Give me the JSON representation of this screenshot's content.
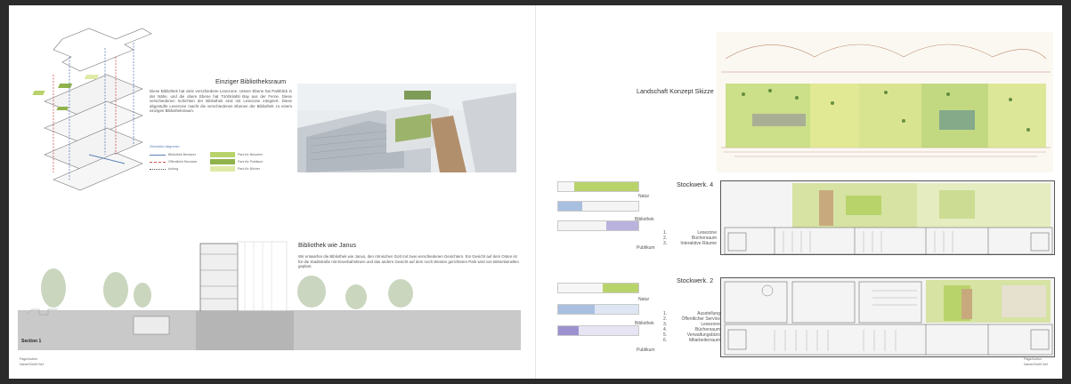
{
  "left_page": {
    "sec1_title": "Einziger Bibliotheksraum",
    "sec1_text": "Diese Bibliothek hat viele verschiedene Lesezone. Untere Ebene hat Parkblick in der Nähe, und die obere Ebene hat Töölönlahti Bay aus der Ferne. Diese verschiedenen Schichten der Bibliothek sind mit Lesezone integriert. Diese abgestufte Lesezone macht die verschiedenen Ebenen der Bibliothek zu einem einzigen Bibliotheksraum.",
    "legend_title": "Zirkulation diagramm",
    "legend_items": [
      {
        "line": "Bibliothek Benutzer",
        "box": "Park für Benutzer"
      },
      {
        "line": "Öffentliche Benutzer",
        "box": "Park für Publikum"
      },
      {
        "line": "Aufzug",
        "box": "Park für Bücher"
      }
    ],
    "sec2_title": "Bibliothek wie Janus",
    "sec2_text": "Wir entwarfen die Bibliothek wie Janus, den römischen Gott mit zwei verschiedenen Gesichtern. Ein Gesicht auf dem Osten ist für die Stadtstraße mit Eisenbahnlinien und das andere Gesicht auf dem noch Westen gerichteten Park wird von Birkenlamellen geplant.",
    "section_label": "Section 1",
    "footer_1": "Page/Author",
    "footer_2": "Name/Chef/Chef"
  },
  "right_page": {
    "sketch_title": "Landschaft Konzept Skizze",
    "floor4_title": "Stockwerk. 4",
    "floor2_title": "Stockwerk. 2",
    "bar_labels": [
      "Natur",
      "Bibliothek",
      "Publikum"
    ],
    "floor4_list": [
      {
        "n": "1.",
        "label": "Lesezone"
      },
      {
        "n": "2.",
        "label": "Büchersaum"
      },
      {
        "n": "3.",
        "label": "Interaktive Räume"
      }
    ],
    "floor2_list": [
      {
        "n": "1.",
        "label": "Ausstellung"
      },
      {
        "n": "2.",
        "label": "Öffentlicher Service"
      },
      {
        "n": "3.",
        "label": "Lesezone"
      },
      {
        "n": "4.",
        "label": "Büchersaum"
      },
      {
        "n": "5.",
        "label": "Verwaltungsbüro"
      },
      {
        "n": "6.",
        "label": "Mitarbeiterraum"
      }
    ],
    "footer_1": "Page/Author",
    "footer_2": "Name/Chef/Chef"
  },
  "colors": {
    "green_light": "#dfe9a6",
    "green_mid": "#b9d36b",
    "green_dark": "#8fb24a",
    "blue": "#5b7fb8",
    "purple": "#7d6fb6",
    "wood": "#c8a97e"
  }
}
